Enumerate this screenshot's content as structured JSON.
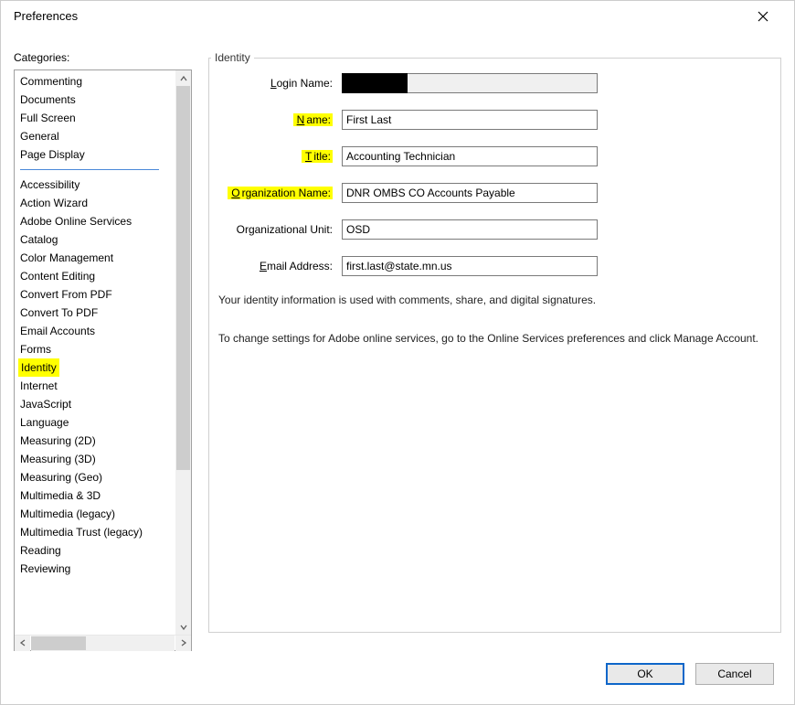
{
  "window": {
    "title": "Preferences"
  },
  "sidebar": {
    "label": "Categories:",
    "group1": [
      {
        "label": "Commenting"
      },
      {
        "label": "Documents"
      },
      {
        "label": "Full Screen"
      },
      {
        "label": "General"
      },
      {
        "label": "Page Display"
      }
    ],
    "group2": [
      {
        "label": "Accessibility"
      },
      {
        "label": "Action Wizard"
      },
      {
        "label": "Adobe Online Services"
      },
      {
        "label": "Catalog"
      },
      {
        "label": "Color Management"
      },
      {
        "label": "Content Editing"
      },
      {
        "label": "Convert From PDF"
      },
      {
        "label": "Convert To PDF"
      },
      {
        "label": "Email Accounts"
      },
      {
        "label": "Forms"
      },
      {
        "label": "Identity",
        "selected": true,
        "highlighted": true
      },
      {
        "label": "Internet"
      },
      {
        "label": "JavaScript"
      },
      {
        "label": "Language"
      },
      {
        "label": "Measuring (2D)"
      },
      {
        "label": "Measuring (3D)"
      },
      {
        "label": "Measuring (Geo)"
      },
      {
        "label": "Multimedia & 3D"
      },
      {
        "label": "Multimedia (legacy)"
      },
      {
        "label": "Multimedia Trust (legacy)"
      },
      {
        "label": "Reading"
      },
      {
        "label": "Reviewing"
      }
    ]
  },
  "panel": {
    "legend": "Identity",
    "fields": {
      "login_name_label": "Login Name:",
      "login_name_value": "",
      "name_label": "Name:",
      "name_value": "First Last",
      "title_label": "Title:",
      "title_value": "Accounting Technician",
      "org_name_label": "Organization Name:",
      "org_name_value": "DNR OMBS CO Accounts Payable",
      "org_unit_label": "Organizational Unit:",
      "org_unit_value": "OSD",
      "email_label": "Email Address:",
      "email_value": "first.last@state.mn.us"
    },
    "info1": "Your identity information is used with comments, share, and digital signatures.",
    "info2": "To change settings for Adobe online services, go to the Online Services preferences and click Manage Account."
  },
  "buttons": {
    "ok": "OK",
    "cancel": "Cancel"
  }
}
